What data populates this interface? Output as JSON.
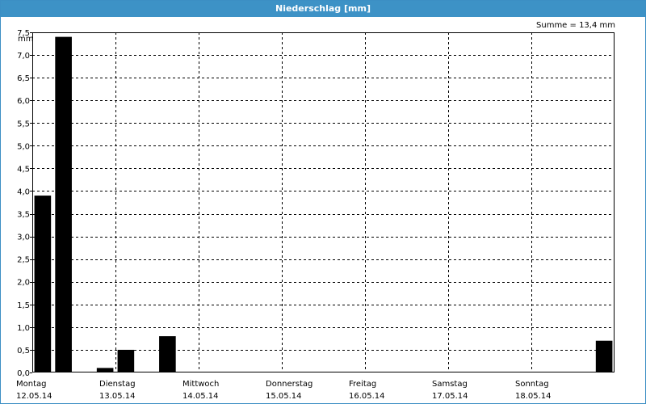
{
  "window": {
    "title": "Niederschlag [mm]"
  },
  "summary": "Summe = 13,4 mm",
  "chart_data": {
    "type": "bar",
    "title": "Niederschlag [mm]",
    "ylabel": "mm",
    "ylim": [
      0,
      7.5
    ],
    "ytick_step": 0.5,
    "yticks": [
      "0,0",
      "0,5",
      "1,0",
      "1,5",
      "2,0",
      "2,5",
      "3,0",
      "3,5",
      "4,0",
      "4,5",
      "5,0",
      "5,5",
      "6,0",
      "6,5",
      "7,0",
      "7,5"
    ],
    "x_days": [
      {
        "day": "Montag",
        "date": "12.05.14"
      },
      {
        "day": "Dienstag",
        "date": "13.05.14"
      },
      {
        "day": "Mittwoch",
        "date": "14.05.14"
      },
      {
        "day": "Donnerstag",
        "date": "15.05.14"
      },
      {
        "day": "Freitag",
        "date": "16.05.14"
      },
      {
        "day": "Samstag",
        "date": "17.05.14"
      },
      {
        "day": "Sonntag",
        "date": "18.05.14"
      }
    ],
    "bar_interval_hours": 6,
    "values": [
      3.9,
      7.4,
      0,
      0.1,
      0.5,
      0,
      0.8,
      0,
      0,
      0,
      0,
      0,
      0,
      0,
      0,
      0,
      0,
      0,
      0,
      0,
      0,
      0,
      0,
      0,
      0,
      0,
      0,
      0.7
    ],
    "bar_color": "#000000",
    "grid": true
  }
}
